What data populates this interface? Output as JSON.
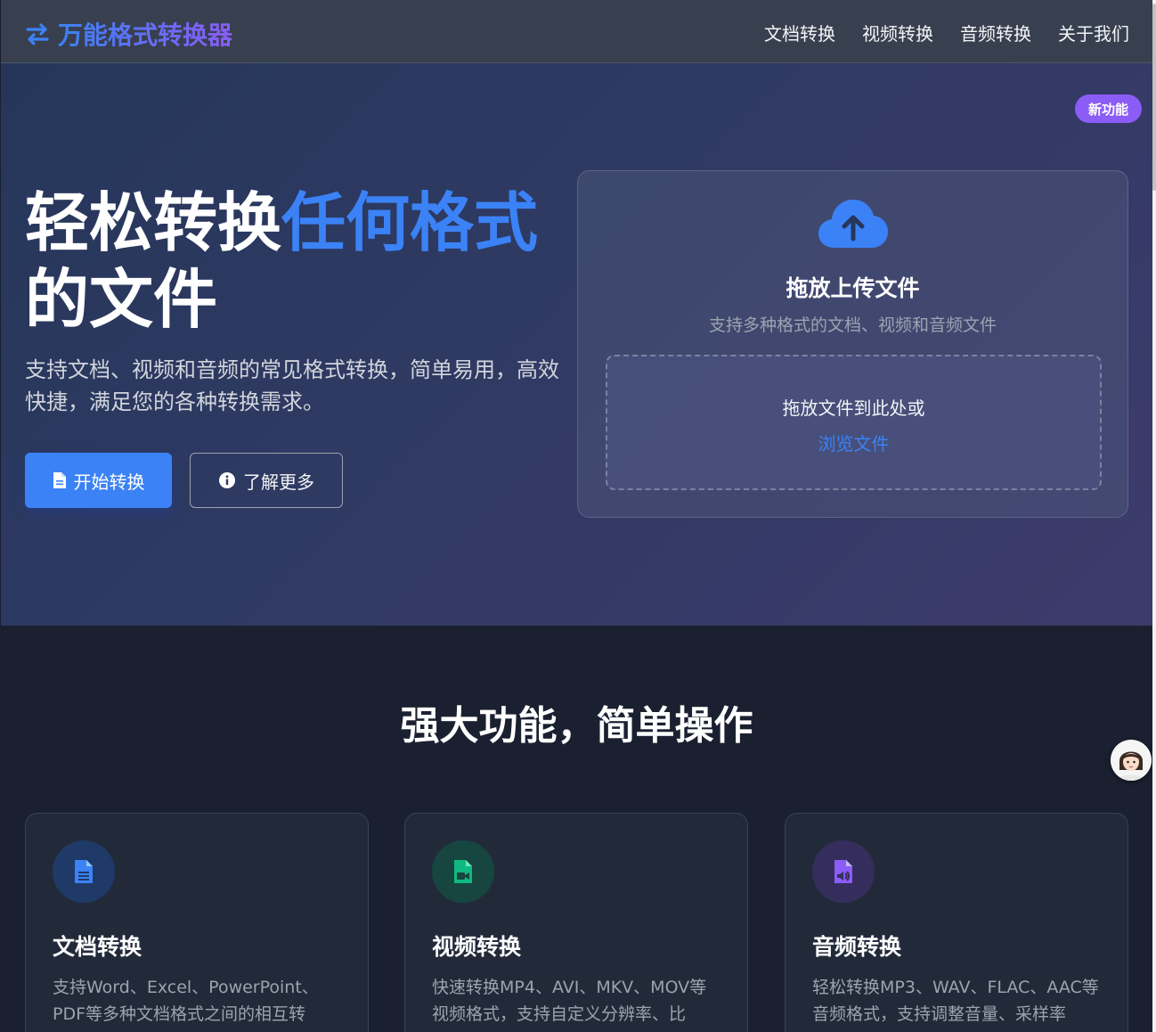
{
  "nav": {
    "logo_text": "万能格式转换器",
    "links": [
      "文档转换",
      "视频转换",
      "音频转换",
      "关于我们"
    ]
  },
  "hero": {
    "title_part1": "轻松转换",
    "title_highlight": "任何格式",
    "title_part2": "的文件",
    "description": "支持文档、视频和音频的常见格式转换，简单易用，高效快捷，满足您的各种转换需求。",
    "primary_button": "开始转换",
    "secondary_button": "了解更多"
  },
  "upload": {
    "badge": "新功能",
    "title": "拖放上传文件",
    "subtitle": "支持多种格式的文档、视频和音频文件",
    "drop_text": "拖放文件到此处或",
    "browse_text": "浏览文件"
  },
  "features": {
    "title": "强大功能，简单操作",
    "cards": [
      {
        "icon": "document-icon",
        "title": "文档转换",
        "description": "支持Word、Excel、PowerPoint、PDF等多种文档格式之间的相互转",
        "color": "#3b82f6"
      },
      {
        "icon": "video-file-icon",
        "title": "视频转换",
        "description": "快速转换MP4、AVI、MKV、MOV等视频格式，支持自定义分辨率、比",
        "color": "#10b981"
      },
      {
        "icon": "audio-file-icon",
        "title": "音频转换",
        "description": "轻松转换MP3、WAV、FLAC、AAC等音频格式，支持调整音量、采样率",
        "color": "#8b5cf6"
      }
    ]
  },
  "colors": {
    "accent": "#3b82f6",
    "purple": "#8b5cf6",
    "green": "#10b981"
  }
}
